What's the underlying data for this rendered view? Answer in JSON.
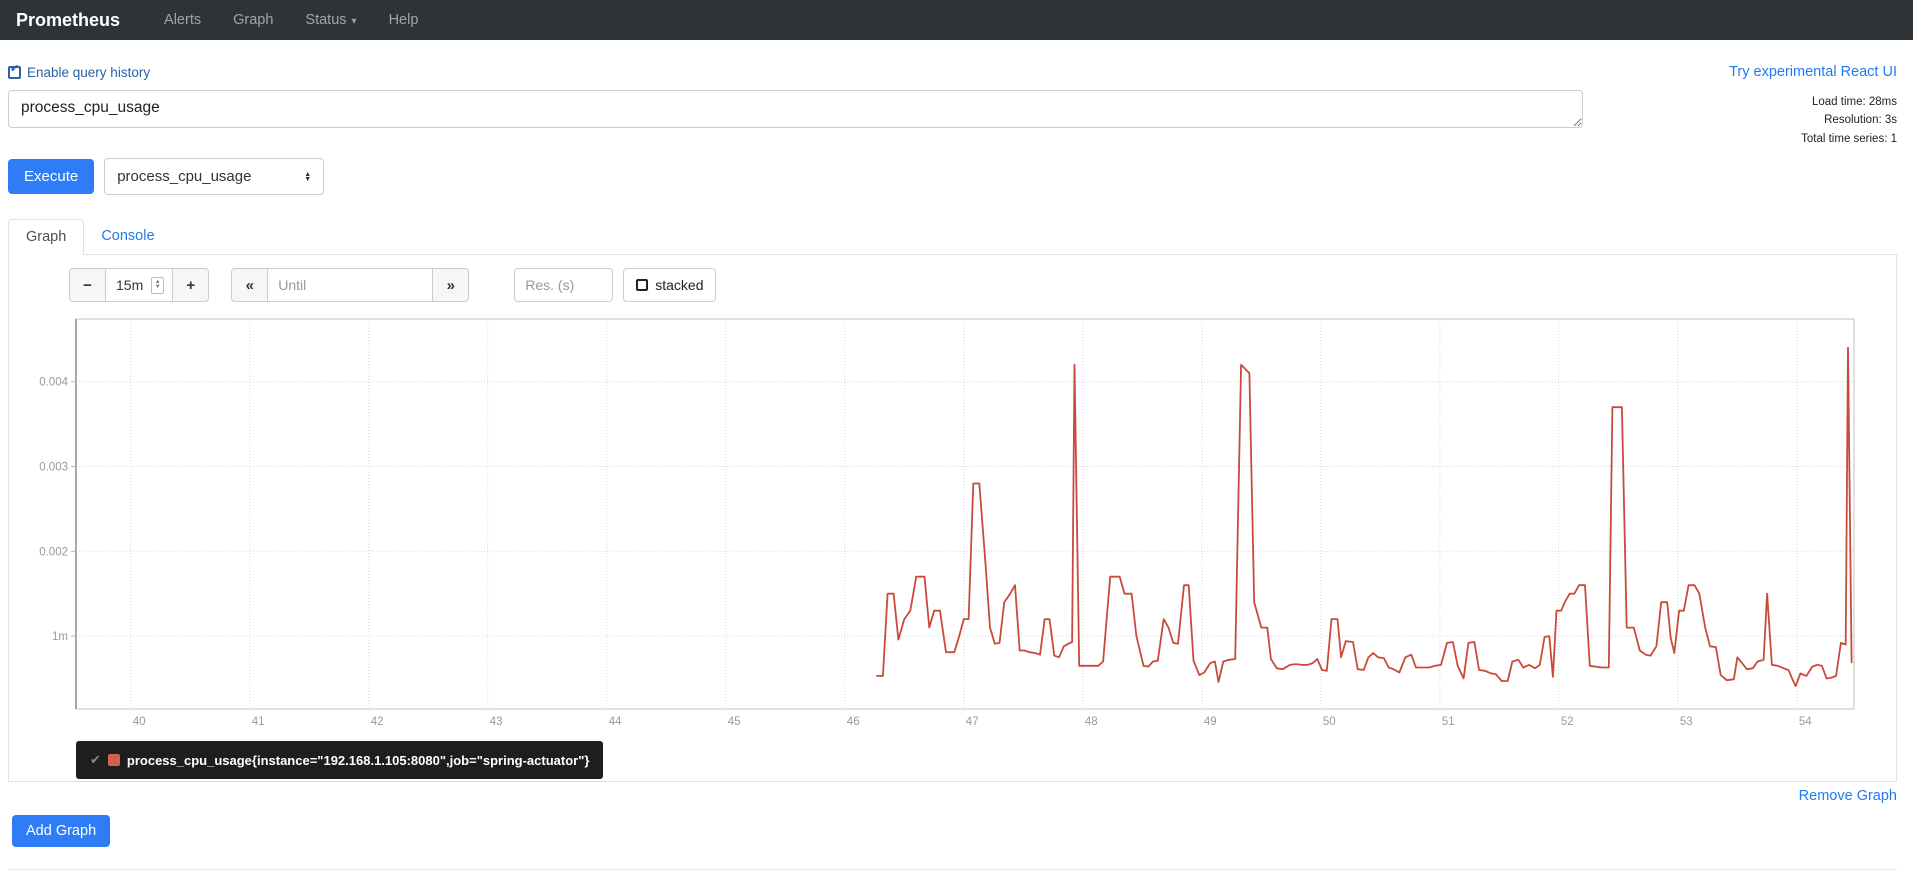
{
  "navbar": {
    "brand": "Prometheus",
    "items": [
      {
        "label": "Alerts"
      },
      {
        "label": "Graph"
      },
      {
        "label": "Status",
        "caret": "▾"
      },
      {
        "label": "Help"
      }
    ]
  },
  "toolbar": {
    "enable_query_history": "Enable query history",
    "react_ui_link": "Try experimental React UI"
  },
  "query": {
    "value": "process_cpu_usage",
    "stats": {
      "load_time": "Load time: 28ms",
      "resolution": "Resolution: 3s",
      "total_series": "Total time series: 1"
    },
    "execute_label": "Execute",
    "metric_selected": "process_cpu_usage"
  },
  "tabs": {
    "graph": "Graph",
    "console": "Console"
  },
  "controls": {
    "minus": "−",
    "range_value": "15m",
    "plus": "+",
    "step_back": "«",
    "until_placeholder": "Until",
    "step_forward": "»",
    "res_placeholder": "Res. (s)",
    "stacked_label": "stacked"
  },
  "chart_data": {
    "type": "line",
    "xlabel": "",
    "ylabel": "",
    "x_ticks": [
      40,
      41,
      42,
      43,
      44,
      45,
      46,
      47,
      48,
      49,
      50,
      51,
      52,
      53,
      54
    ],
    "x_tick_labels": [
      "40",
      "41",
      "42",
      "43",
      "44",
      "45",
      "46",
      "47",
      "48",
      "49",
      "50",
      "51",
      "52",
      "53",
      "54"
    ],
    "y_ticks": [
      0.001,
      0.002,
      0.003,
      0.004
    ],
    "y_tick_labels": [
      "1m",
      "0.002",
      "0.003",
      "0.004"
    ],
    "xlim": [
      39.54,
      54.48
    ],
    "ylim": [
      0.00014,
      0.00474
    ],
    "grid": "dotted",
    "legend_position": "bottom-left",
    "series": [
      {
        "name": "process_cpu_usage{instance=\"192.168.1.105:8080\",job=\"spring-actuator\"}",
        "color": "#c94a3b",
        "points": [
          [
            46.27,
            0.00053
          ],
          [
            46.32,
            0.00053
          ],
          [
            46.36,
            0.0015
          ],
          [
            46.41,
            0.0015
          ],
          [
            46.45,
            0.00096
          ],
          [
            46.5,
            0.0012
          ],
          [
            46.55,
            0.0013
          ],
          [
            46.6,
            0.0017
          ],
          [
            46.67,
            0.0017
          ],
          [
            46.71,
            0.0011
          ],
          [
            46.75,
            0.0013
          ],
          [
            46.8,
            0.0013
          ],
          [
            46.85,
            0.00081
          ],
          [
            46.92,
            0.00081
          ],
          [
            46.96,
            0.00099
          ],
          [
            47.0,
            0.0012
          ],
          [
            47.04,
            0.0012
          ],
          [
            47.08,
            0.0028
          ],
          [
            47.13,
            0.0028
          ],
          [
            47.18,
            0.0019
          ],
          [
            47.22,
            0.0011
          ],
          [
            47.26,
            0.00091
          ],
          [
            47.3,
            0.00092
          ],
          [
            47.34,
            0.0014
          ],
          [
            47.39,
            0.0015
          ],
          [
            47.43,
            0.0016
          ],
          [
            47.47,
            0.00083
          ],
          [
            47.51,
            0.00083
          ],
          [
            47.55,
            0.00081
          ],
          [
            47.6,
            0.0008
          ],
          [
            47.64,
            0.00078
          ],
          [
            47.68,
            0.0012
          ],
          [
            47.72,
            0.0012
          ],
          [
            47.76,
            0.00077
          ],
          [
            47.8,
            0.00075
          ],
          [
            47.84,
            0.00088
          ],
          [
            47.88,
            0.00091
          ],
          [
            47.91,
            0.00093
          ],
          [
            47.93,
            0.0042
          ],
          [
            47.97,
            0.00065
          ],
          [
            48.05,
            0.00065
          ],
          [
            48.13,
            0.00065
          ],
          [
            48.17,
            0.0007
          ],
          [
            48.23,
            0.0017
          ],
          [
            48.31,
            0.0017
          ],
          [
            48.35,
            0.0015
          ],
          [
            48.41,
            0.0015
          ],
          [
            48.45,
            0.001
          ],
          [
            48.51,
            0.00065
          ],
          [
            48.55,
            0.00064
          ],
          [
            48.59,
            0.0007
          ],
          [
            48.63,
            0.00071
          ],
          [
            48.68,
            0.0012
          ],
          [
            48.72,
            0.0011
          ],
          [
            48.76,
            0.00092
          ],
          [
            48.8,
            0.00091
          ],
          [
            48.85,
            0.0016
          ],
          [
            48.89,
            0.0016
          ],
          [
            48.93,
            0.00071
          ],
          [
            48.98,
            0.00054
          ],
          [
            49.02,
            0.00057
          ],
          [
            49.07,
            0.00068
          ],
          [
            49.11,
            0.0007
          ],
          [
            49.14,
            0.00046
          ],
          [
            49.18,
            0.0007
          ],
          [
            49.23,
            0.00072
          ],
          [
            49.28,
            0.00073
          ],
          [
            49.33,
            0.0042
          ],
          [
            49.4,
            0.0041
          ],
          [
            49.44,
            0.0014
          ],
          [
            49.5,
            0.0011
          ],
          [
            49.55,
            0.0011
          ],
          [
            49.58,
            0.00073
          ],
          [
            49.63,
            0.00062
          ],
          [
            49.68,
            0.00061
          ],
          [
            49.74,
            0.00066
          ],
          [
            49.79,
            0.00067
          ],
          [
            49.84,
            0.00066
          ],
          [
            49.89,
            0.00066
          ],
          [
            49.93,
            0.00068
          ],
          [
            49.97,
            0.00073
          ],
          [
            50.01,
            0.0006
          ],
          [
            50.05,
            0.00059
          ],
          [
            50.09,
            0.0012
          ],
          [
            50.14,
            0.0012
          ],
          [
            50.17,
            0.00075
          ],
          [
            50.21,
            0.00094
          ],
          [
            50.27,
            0.00093
          ],
          [
            50.31,
            0.00061
          ],
          [
            50.36,
            0.0006
          ],
          [
            50.4,
            0.00075
          ],
          [
            50.44,
            0.0008
          ],
          [
            50.48,
            0.00075
          ],
          [
            50.53,
            0.00074
          ],
          [
            50.57,
            0.00063
          ],
          [
            50.61,
            0.00061
          ],
          [
            50.66,
            0.00057
          ],
          [
            50.71,
            0.00075
          ],
          [
            50.76,
            0.00078
          ],
          [
            50.8,
            0.00063
          ],
          [
            50.86,
            0.00063
          ],
          [
            50.91,
            0.00063
          ],
          [
            50.96,
            0.00065
          ],
          [
            51.01,
            0.00066
          ],
          [
            51.06,
            0.00092
          ],
          [
            51.11,
            0.00093
          ],
          [
            51.15,
            0.00065
          ],
          [
            51.2,
            0.0005
          ],
          [
            51.24,
            0.00092
          ],
          [
            51.29,
            0.00093
          ],
          [
            51.33,
            0.0006
          ],
          [
            51.38,
            0.00059
          ],
          [
            51.43,
            0.00056
          ],
          [
            51.47,
            0.00055
          ],
          [
            51.52,
            0.00047
          ],
          [
            51.57,
            0.00047
          ],
          [
            51.61,
            0.0007
          ],
          [
            51.66,
            0.00072
          ],
          [
            51.7,
            0.00063
          ],
          [
            51.75,
            0.00066
          ],
          [
            51.8,
            0.00062
          ],
          [
            51.84,
            0.00066
          ],
          [
            51.88,
            0.00099
          ],
          [
            51.92,
            0.001
          ],
          [
            51.95,
            0.00052
          ],
          [
            51.98,
            0.0013
          ],
          [
            52.02,
            0.0013
          ],
          [
            52.05,
            0.0014
          ],
          [
            52.09,
            0.0015
          ],
          [
            52.13,
            0.0015
          ],
          [
            52.17,
            0.0016
          ],
          [
            52.22,
            0.0016
          ],
          [
            52.26,
            0.00065
          ],
          [
            52.31,
            0.00064
          ],
          [
            52.36,
            0.00063
          ],
          [
            52.42,
            0.00063
          ],
          [
            52.45,
            0.0037
          ],
          [
            52.53,
            0.0037
          ],
          [
            52.57,
            0.0011
          ],
          [
            52.63,
            0.0011
          ],
          [
            52.68,
            0.00083
          ],
          [
            52.73,
            0.00078
          ],
          [
            52.77,
            0.00077
          ],
          [
            52.82,
            0.00088
          ],
          [
            52.86,
            0.0014
          ],
          [
            52.91,
            0.0014
          ],
          [
            52.94,
            0.00098
          ],
          [
            52.97,
            0.0008
          ],
          [
            53.01,
            0.0013
          ],
          [
            53.05,
            0.0013
          ],
          [
            53.09,
            0.0016
          ],
          [
            53.14,
            0.0016
          ],
          [
            53.18,
            0.0015
          ],
          [
            53.23,
            0.0011
          ],
          [
            53.27,
            0.00088
          ],
          [
            53.32,
            0.00087
          ],
          [
            53.36,
            0.00054
          ],
          [
            53.41,
            0.00048
          ],
          [
            53.47,
            0.00049
          ],
          [
            53.5,
            0.00075
          ],
          [
            53.54,
            0.00068
          ],
          [
            53.58,
            0.00061
          ],
          [
            53.63,
            0.00062
          ],
          [
            53.67,
            0.0007
          ],
          [
            53.72,
            0.00072
          ],
          [
            53.75,
            0.0015
          ],
          [
            53.79,
            0.00066
          ],
          [
            53.84,
            0.00065
          ],
          [
            53.89,
            0.00062
          ],
          [
            53.93,
            0.0006
          ],
          [
            53.96,
            0.0005
          ],
          [
            53.99,
            0.00041
          ],
          [
            54.03,
            0.00056
          ],
          [
            54.08,
            0.00053
          ],
          [
            54.13,
            0.00064
          ],
          [
            54.17,
            0.00066
          ],
          [
            54.21,
            0.00065
          ],
          [
            54.25,
            0.0005
          ],
          [
            54.29,
            0.00051
          ],
          [
            54.33,
            0.00053
          ],
          [
            54.37,
            0.00092
          ],
          [
            54.41,
            0.0009
          ],
          [
            54.43,
            0.0044
          ],
          [
            54.46,
            0.00069
          ]
        ]
      }
    ]
  },
  "legend": {
    "check": "✔",
    "series_label": "process_cpu_usage{instance=\"192.168.1.105:8080\",job=\"spring-actuator\"}",
    "swatch_color": "#d4604e"
  },
  "footer": {
    "remove_graph": "Remove Graph",
    "add_graph": "Add Graph"
  },
  "colors": {
    "navbar_bg": "#2e3338",
    "link_blue": "#1f7bf4",
    "primary_button": "#2e7cf6",
    "series_line": "#c94a3b",
    "grid_line": "#d8d8d8",
    "tick_label": "#999999"
  }
}
